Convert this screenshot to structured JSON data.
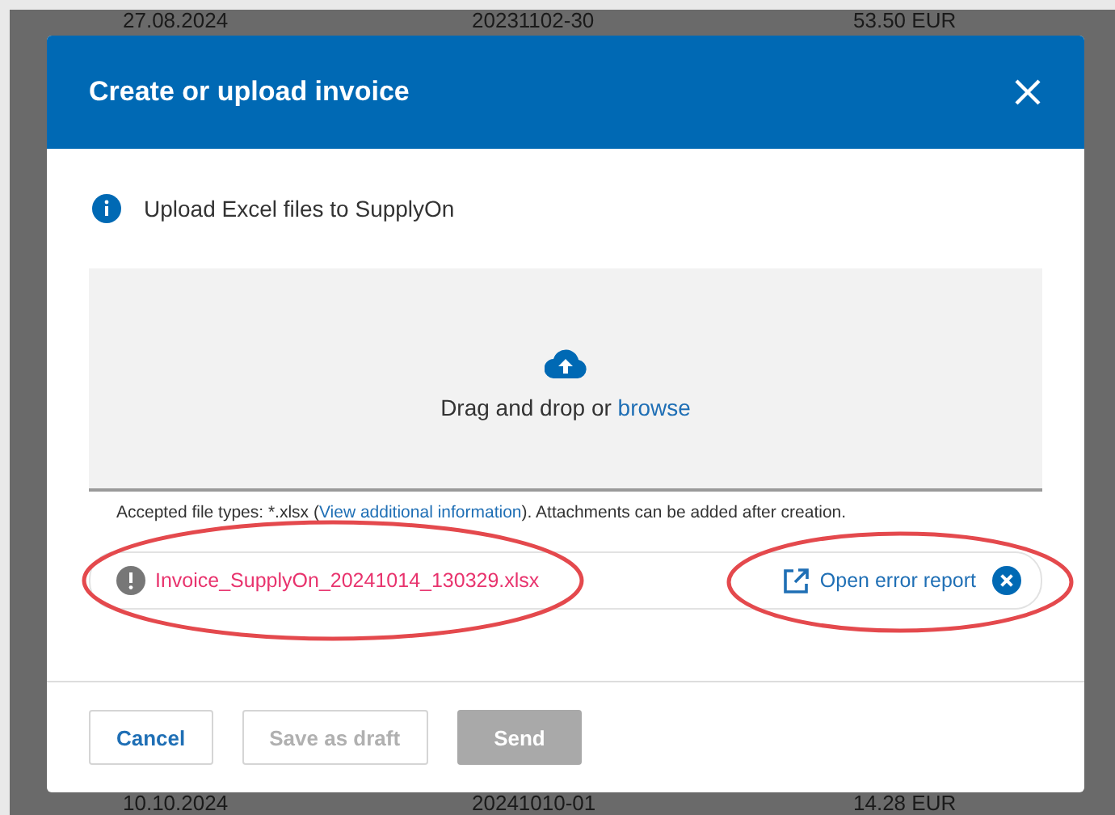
{
  "background_table": {
    "rows": [
      {
        "cells": [
          "27.08.2024",
          "20231102-30",
          "53.50 EUR"
        ]
      },
      {
        "cells": [
          "10.10.2024",
          "20241010-01",
          "14.28 EUR"
        ]
      }
    ]
  },
  "dialog": {
    "title": "Create or upload invoice",
    "info": "Upload Excel files to SupplyOn",
    "dropzone": {
      "text": "Drag and drop or ",
      "link": "browse"
    },
    "accepted": {
      "before": "Accepted file types: *.xlsx (",
      "link": "View additional information",
      "after": "). Attachments can be added after creation."
    },
    "file": {
      "name": "Invoice_SupplyOn_20241014_130329.xlsx",
      "error": true,
      "highlighted": true,
      "report_link": {
        "label": "Open error report",
        "highlighted": true
      }
    },
    "buttons": [
      {
        "label": "Cancel",
        "kind": "secondary",
        "disabled": false
      },
      {
        "label": "Save as draft",
        "kind": "secondary",
        "disabled": true
      },
      {
        "label": "Send",
        "kind": "primary",
        "disabled": true
      }
    ]
  }
}
